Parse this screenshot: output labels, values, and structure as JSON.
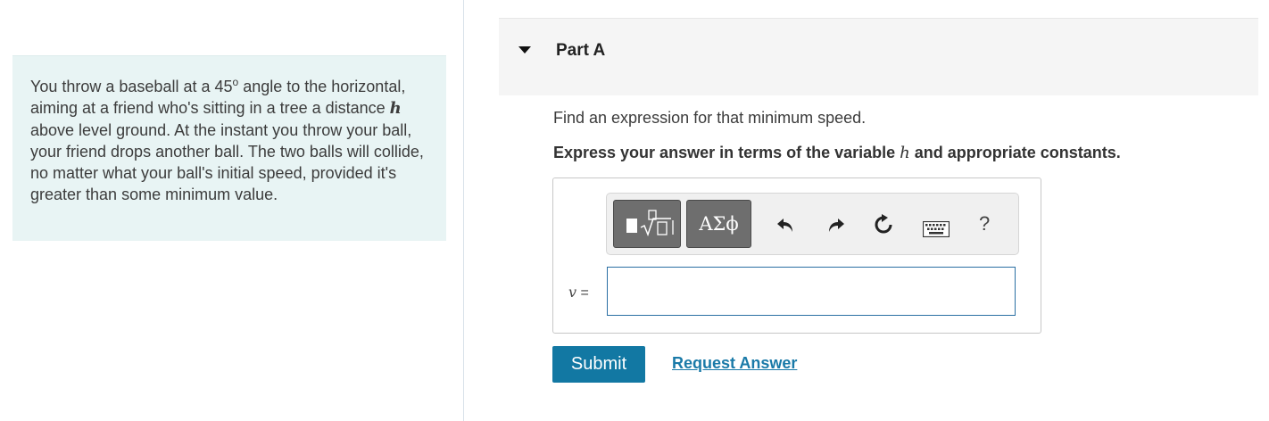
{
  "problem": {
    "text_before_angle": "You throw a baseball at a 45",
    "angle_unit": "o",
    "text_mid": " angle to the horizontal, aiming at a friend who's sitting in a tree a distance ",
    "variable": "h",
    "text_after": " above level ground. At the instant you throw your ball, your friend drops another ball. The two balls will collide, no matter what your ball's initial speed, provided it's greater than some minimum value."
  },
  "part": {
    "title": "Part A",
    "instruction": "Find an expression for that minimum speed.",
    "express_before": "Express your answer in terms of the variable ",
    "express_variable": "h",
    "express_after": " and appropriate constants."
  },
  "toolbar": {
    "greek_label": "ΑΣϕ",
    "help_label": "?",
    "icons": [
      "templates-icon",
      "greek-symbols-icon",
      "undo-icon",
      "redo-icon",
      "reset-icon",
      "keyboard-icon",
      "help-icon"
    ]
  },
  "answer": {
    "variable": "v",
    "equals": "=",
    "value": "",
    "placeholder": ""
  },
  "actions": {
    "submit_label": "Submit",
    "request_label": "Request Answer"
  },
  "colors": {
    "problem_bg": "#e8f4f4",
    "submit_bg": "#1278a3",
    "link": "#1a7aa8",
    "input_border": "#2a6fa3"
  }
}
